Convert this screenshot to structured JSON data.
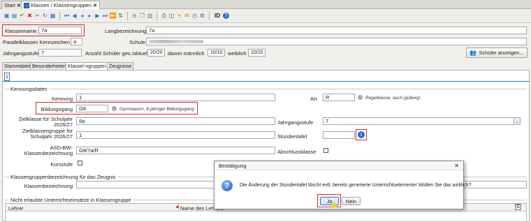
{
  "tabs": [
    {
      "label": "Start",
      "active": false
    },
    {
      "label": "Klassen / Klassengruppen",
      "active": true
    }
  ],
  "toolbar": {
    "icons": [
      "new-icon",
      "save-icon",
      "undo-icon",
      "delete-icon",
      "cut-icon",
      "refresh-icon",
      "filter-icon",
      "first-icon",
      "previous-icon",
      "previous-small-icon",
      "next-small-icon",
      "next-icon",
      "last-icon",
      "filter-next-icon",
      "sort-icon",
      "delete-row-icon",
      "copy-icon",
      "paste-icon",
      "print-icon",
      "preview-icon",
      "hint-icon",
      "mail-icon",
      "clock-icon",
      "settings-icon",
      "id-icon",
      "help-icon"
    ],
    "id_label": "ID"
  },
  "header": {
    "klassenname_label": "Klassenname",
    "klassenname_value": "7a",
    "langbezeichnung_label": "Langbezeichnung",
    "langbezeichnung_value": "7a",
    "parallel_label": "Parallelklassen Kennzeichen",
    "parallel_value": "a",
    "schule_label": "Schule",
    "jahrgangsstufe_label": "Jahrgangsstufe",
    "jahrgangsstufe_value": "7",
    "anzahl_label": "Anzahl Schüler ges./aktuell",
    "anzahl_value": "20/20",
    "maennlich_label": "davon männlich",
    "maennlich_value": "10/10",
    "weiblich_label": "weiblich",
    "weiblich_value": "10/10",
    "schueler_button": "Schüler anzeigen..."
  },
  "subtabs": [
    "Stammdaten",
    "Besonderheiten",
    "Klasse/-ngruppen",
    "Zeugnisse"
  ],
  "page_tab": "1",
  "kennungsdaten": {
    "title": "Kennungsdaten",
    "kennung_label": "Kennung",
    "kennung_value": "1",
    "art_label": "Art",
    "art_value": "R",
    "art_hint": "Regelklasse, auch jgübergr.",
    "bildungsgang_label": "Bildungsgang",
    "bildungsgang_value": "G8",
    "bildungsgang_hint": "Gymnasium, 8-jähriger Bildungsgang",
    "zielklasse_label": "Zielklasse für Schuljahr 2026/27",
    "zielklasse_value": "8a",
    "jahrgangsstufe_label": "Jahrgangsstufe",
    "jahrgangsstufe_value": "7",
    "zielgruppe_label": "Zielklassengruppe für Schuljahr 2026/27",
    "zielgruppe_value": "1",
    "stundentafel_label": "Stundentafel",
    "stundentafel_value": "",
    "asd_label": "ASD-BW-Klassenbezeichnung",
    "asd_value": "G8/7a/R",
    "abschluss_label": "Abschlussklasse",
    "kursstufe_label": "Kursstufe"
  },
  "zeugnis": {
    "title": "Klassengruppenbezeichnung für das Zeugnis",
    "bezeichnung_label": "Klassenbezeichnung",
    "bezeichnung_value": ""
  },
  "einsaetze": {
    "title": "Nicht erlaubte Unterrichtseinsätze in Klassengruppe",
    "columns": [
      "Lehrer",
      "Name des Lehrers"
    ]
  },
  "dialog": {
    "title": "Bestätigung",
    "message": "Die Änderung der Stundentafel löscht evtl. bereits generierte Unterrichtselemente! Wollen Sie das wirklich?",
    "yes": "Ja",
    "no": "Nein"
  }
}
